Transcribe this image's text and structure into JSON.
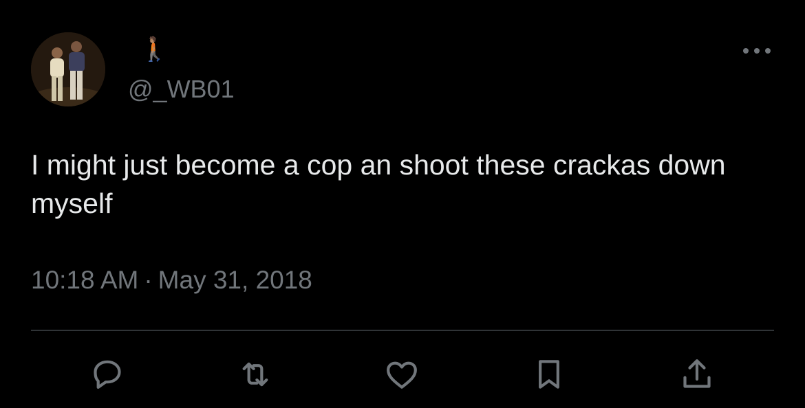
{
  "tweet": {
    "display_name": "🚶🏽",
    "handle": "@_WB01",
    "text": "I might just become a cop an shoot these crackas down myself",
    "time": "10:18 AM",
    "separator": "·",
    "date": "May 31, 2018"
  },
  "icons": {
    "more": "more-icon",
    "reply": "reply-icon",
    "retweet": "retweet-icon",
    "like": "like-icon",
    "bookmark": "bookmark-icon",
    "share": "share-icon"
  },
  "colors": {
    "background": "#000000",
    "text": "#e7e9ea",
    "secondary": "#71767b",
    "divider": "#2f3336"
  }
}
